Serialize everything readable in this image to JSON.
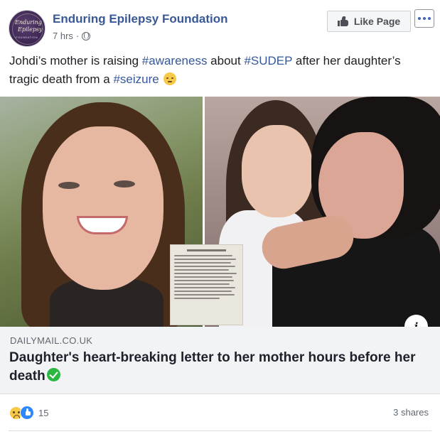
{
  "header": {
    "page_name": "Enduring Epilepsy Foundation",
    "timestamp": "7 hrs",
    "separator": "·",
    "like_page_label": "Like Page",
    "avatar_text_1": "Enduring",
    "avatar_text_2": "Epilepsy",
    "avatar_text_3": "FOUNDATION"
  },
  "post": {
    "text_1": "Johdi’s mother is raising ",
    "tag_1": "#awareness",
    "text_2": " about ",
    "tag_2": "#SUDEP",
    "text_3": " after her daughter’s tragic death from a ",
    "tag_3": "#seizure"
  },
  "link": {
    "info_label": "i",
    "domain": "DAILYMAIL.CO.UK",
    "title": "Daughter's heart-breaking letter to her mother hours before her death"
  },
  "footer": {
    "reaction_count": "15",
    "shares": "3 shares"
  },
  "colors": {
    "link_blue": "#385898",
    "hashtag": "#365899",
    "caption_bg": "#f2f3f5",
    "verified_green": "#2cb742",
    "like_blue": "#2d88ff"
  }
}
